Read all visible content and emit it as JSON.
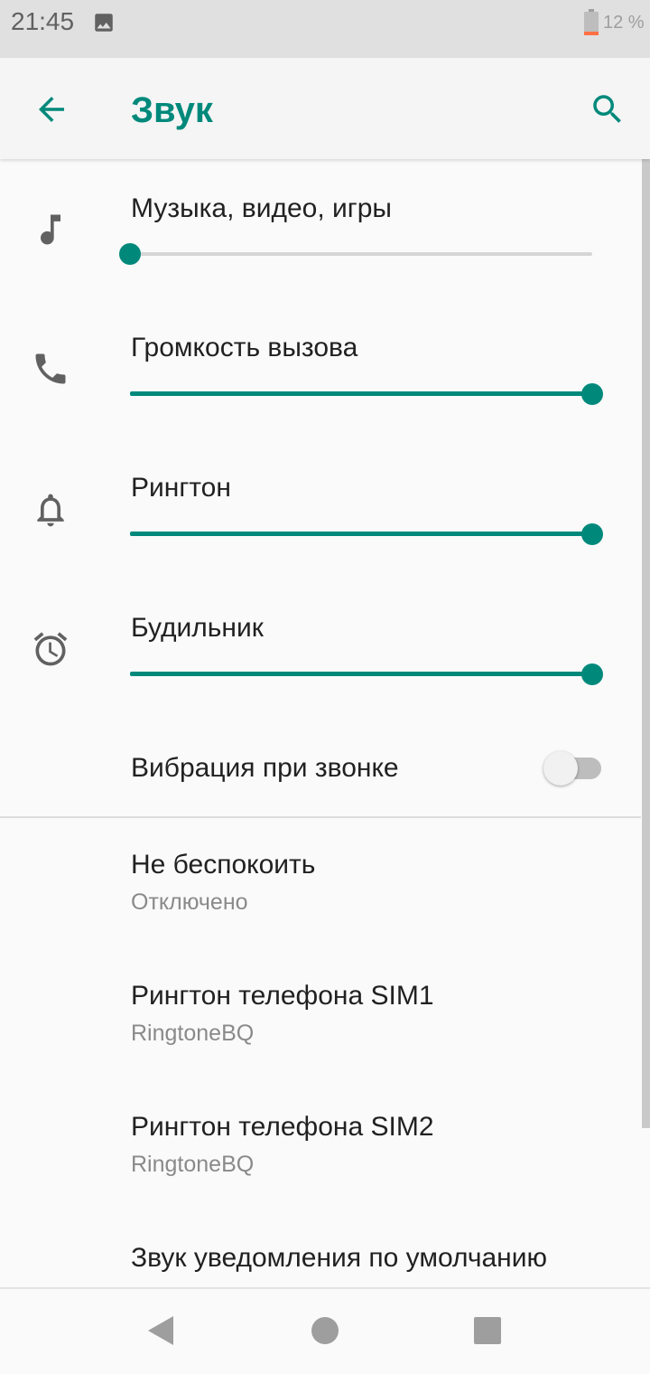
{
  "status_bar": {
    "time": "21:45",
    "battery": "12 %",
    "icons": [
      "image-icon",
      "battery-icon"
    ]
  },
  "app_bar": {
    "title": "Звук",
    "back_icon": "arrow-back-icon",
    "search_icon": "search-icon",
    "accent_color": "#00897b"
  },
  "volume": {
    "music": {
      "label": "Музыка, видео, игры",
      "level": 0,
      "icon": "music-note-icon"
    },
    "call": {
      "label": "Громкость вызова",
      "level": 1,
      "icon": "phone-icon"
    },
    "ringtone": {
      "label": "Рингтон",
      "level": 1,
      "icon": "bell-icon"
    },
    "alarm": {
      "label": "Будильник",
      "level": 1,
      "icon": "alarm-clock-icon"
    }
  },
  "vibration": {
    "label": "Вибрация при звонке",
    "enabled": false
  },
  "preferences": {
    "dnd": {
      "title": "Не беспокоить",
      "summary": "Отключено"
    },
    "sim1": {
      "title": "Рингтон телефона SIM1",
      "summary": "RingtoneBQ"
    },
    "sim2": {
      "title": "Рингтон телефона SIM2",
      "summary": "RingtoneBQ"
    },
    "notification": {
      "title": "Звук уведомления по умолчанию"
    }
  },
  "nav_bar": {
    "icons": [
      "nav-back-icon",
      "nav-home-icon",
      "nav-recents-icon"
    ]
  }
}
